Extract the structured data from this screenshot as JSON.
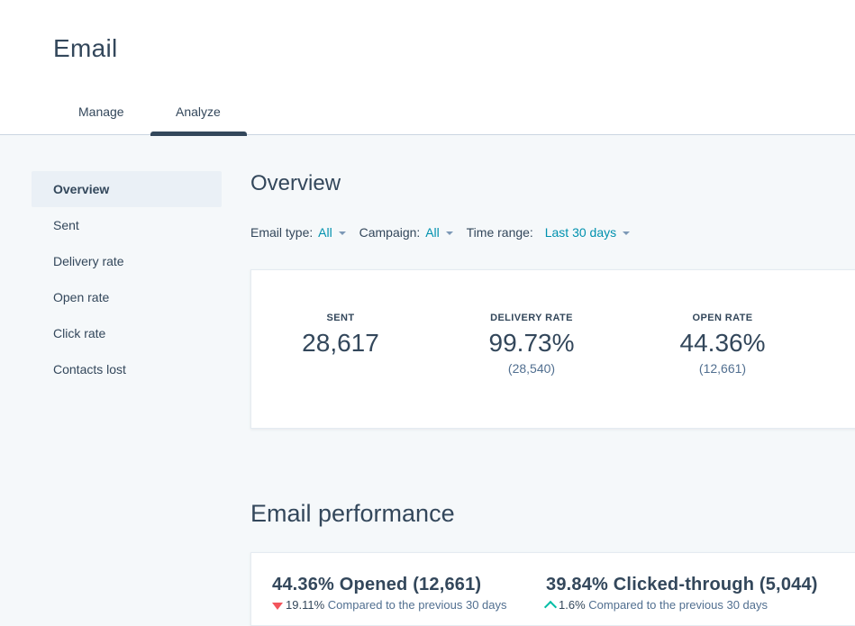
{
  "page": {
    "title": "Email"
  },
  "tabs": [
    {
      "label": "Manage"
    },
    {
      "label": "Analyze",
      "active": true
    }
  ],
  "sidebar": {
    "items": [
      {
        "label": "Overview",
        "active": true
      },
      {
        "label": "Sent"
      },
      {
        "label": "Delivery rate"
      },
      {
        "label": "Open rate"
      },
      {
        "label": "Click rate"
      },
      {
        "label": "Contacts lost"
      }
    ]
  },
  "overview": {
    "title": "Overview",
    "filters": {
      "email_type": {
        "label": "Email type:",
        "value": "All"
      },
      "campaign": {
        "label": "Campaign:",
        "value": "All"
      },
      "time_range": {
        "label": "Time range:",
        "value": "Last 30 days"
      }
    },
    "stats": [
      {
        "label": "SENT",
        "value": "28,617",
        "sub": ""
      },
      {
        "label": "DELIVERY RATE",
        "value": "99.73%",
        "sub": "(28,540)"
      },
      {
        "label": "OPEN RATE",
        "value": "44.36%",
        "sub": "(12,661)"
      }
    ]
  },
  "performance": {
    "title": "Email performance",
    "opened": {
      "title": "44.36% Opened (12,661)",
      "delta": "19.11%",
      "delta_direction": "down",
      "comparison": "Compared to the previous 30 days"
    },
    "clicked": {
      "title": "39.84% Clicked-through (5,044)",
      "delta": "1.6%",
      "delta_direction": "up",
      "comparison": "Compared to the previous 30 days"
    }
  },
  "colors": {
    "text": "#33475b",
    "link": "#0091ae",
    "background": "#f5f8fa",
    "down": "#f2545b",
    "up": "#00bda5"
  }
}
